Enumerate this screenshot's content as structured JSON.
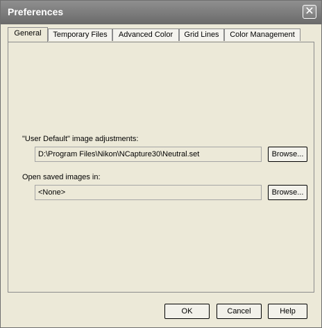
{
  "window": {
    "title": "Preferences",
    "close_symbol": "✕"
  },
  "tabs": [
    {
      "label": "General",
      "active": true
    },
    {
      "label": "Temporary Files",
      "active": false
    },
    {
      "label": "Advanced Color",
      "active": false
    },
    {
      "label": "Grid Lines",
      "active": false
    },
    {
      "label": "Color Management",
      "active": false
    }
  ],
  "general": {
    "user_default_label": "\"User Default\" image adjustments:",
    "user_default_path": "D:\\Program Files\\Nikon\\NCapture30\\Neutral.set",
    "browse_label_1": "Browse...",
    "open_saved_label": "Open saved images in:",
    "open_saved_path": "<None>",
    "browse_label_2": "Browse..."
  },
  "footer": {
    "ok_label": "OK",
    "cancel_label": "Cancel",
    "help_label": "Help"
  },
  "icons": {
    "close": "close-icon"
  }
}
